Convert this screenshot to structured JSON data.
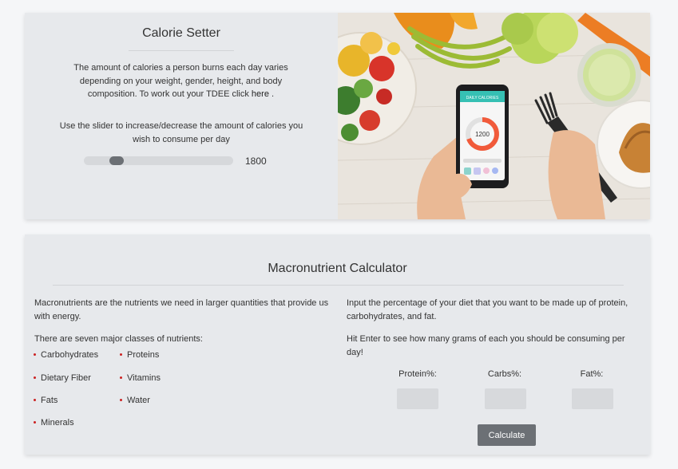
{
  "calorie_setter": {
    "title": "Calorie Setter",
    "description_text": "The amount of calories a person burns each day varies depending on your weight, gender, height, and body composition. To work out your TDEE click",
    "description_link": "here",
    "description_end": ".",
    "slider_label": "Use the slider to increase/decrease the amount of calories you wish to consume per day",
    "slider_value": "1800",
    "slider_fraction": 0.19,
    "image_phone_title": "DAILY CALORIES",
    "image_phone_value": "1200",
    "image_subject": "salad-and-phone-photo"
  },
  "macro_calculator": {
    "title": "Macronutrient Calculator",
    "intro": "Macronutrients are the nutrients we need in larger quantities that provide us with energy.",
    "classes_heading": "There are seven major classes of nutrients:",
    "nutrients": [
      "Carbohydrates",
      "Proteins",
      "Dietary Fiber",
      "Vitamins",
      "Fats",
      "Water",
      "Minerals"
    ],
    "instructions": "Input the percentage of your diet that you want to be made up of protein, carbohydrates, and fat.",
    "hint": "Hit Enter to see how many grams of each you should be consuming per day!",
    "fields": [
      {
        "label": "Protein%:",
        "value": ""
      },
      {
        "label": "Carbs%:",
        "value": ""
      },
      {
        "label": "Fat%:",
        "value": ""
      }
    ],
    "button_label": "Calculate"
  },
  "colors": {
    "card_background": "#e7e9ec",
    "page_background": "#f5f6f8",
    "button": "#6c7075",
    "bullet": "#cc2222"
  }
}
